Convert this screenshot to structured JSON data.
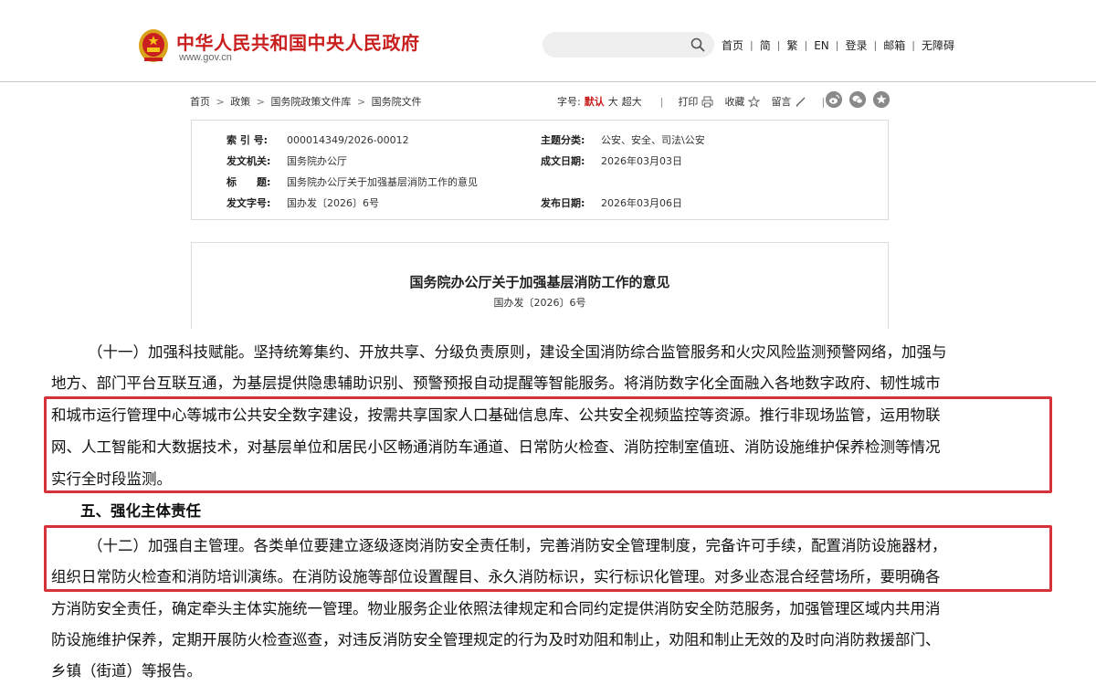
{
  "header": {
    "site_title": "中华人民共和国中央人民政府",
    "site_url": "www.gov.cn",
    "search": {
      "placeholder": ""
    },
    "nav": [
      "首页",
      "简",
      "繁",
      "EN",
      "登录",
      "邮箱",
      "无障碍"
    ],
    "separator": "|"
  },
  "toolbar": {
    "breadcrumb": [
      "首页",
      "政策",
      "国务院政策文件库",
      "国务院文件"
    ],
    "breadcrumb_sep": ">",
    "font_label": "字号:",
    "font_options": [
      "默认",
      "大",
      "超大"
    ],
    "print_label": "打印",
    "favorite_label": "收藏",
    "comment_label": "留言",
    "divider": "|"
  },
  "info": {
    "index_no_label": "索 引 号:",
    "index_no": "000014349/2026-00012",
    "topic_label": "主题分类:",
    "topic": "公安、安全、司法\\公安",
    "issuer_label": "发文机关:",
    "issuer": "国务院办公厅",
    "created_label": "成文日期:",
    "created": "2026年03月03日",
    "title_label": "标　　题:",
    "title": "国务院办公厅关于加强基层消防工作的意见",
    "doc_no_label": "发文字号:",
    "doc_no": "国办发〔2026〕6号",
    "published_label": "发布日期:",
    "published": "2026年03月06日"
  },
  "document": {
    "title": "国务院办公厅关于加强基层消防工作的意见",
    "number": "国办发〔2026〕6号"
  },
  "body": {
    "para11_lines": [
      "（十一）加强科技赋能。坚持统筹集约、开放共享、分级负责原则，建设全国消防综合监管服务和火灾风险监测预警网络，加强与",
      "地方、部门平台互联互通，为基层提供隐患辅助识别、预警预报自动提醒等智能服务。将消防数字化全面融入各地数字政府、韧性城市",
      "和城市运行管理中心等城市公共安全数字建设，按需共享国家人口基础信息库、公共安全视频监控等资源。推行非现场监管，运用物联",
      "网、人工智能和大数据技术，对基层单位和居民小区畅通消防车通道、日常防火检查、消防控制室值班、消防设施维护保养检测等情况",
      "实行全时段监测。"
    ],
    "section5": "五、强化主体责任",
    "para12_lines": [
      "（十二）加强自主管理。各类单位要建立逐级逐岗消防安全责任制，完善消防安全管理制度，完备许可手续，配置消防设施器材，",
      "组织日常防火检查和消防培训演练。在消防设施等部位设置醒目、永久消防标识，实行标识化管理。对多业态混合经营场所，要明确各",
      "方消防安全责任，确定牵头主体实施统一管理。物业服务企业依照法律规定和合同约定提供消防安全防范服务，加强管理区域内共用消",
      "防设施维护保养，定期开展防火检查巡查，对违反消防安全管理规定的行为及时劝阻和制止，劝阻和制止无效的及时向消防救援部门、",
      "乡镇（街道）等报告。"
    ]
  },
  "colors": {
    "brand_red": "#c91f1f",
    "highlight_red": "#d6323a"
  }
}
